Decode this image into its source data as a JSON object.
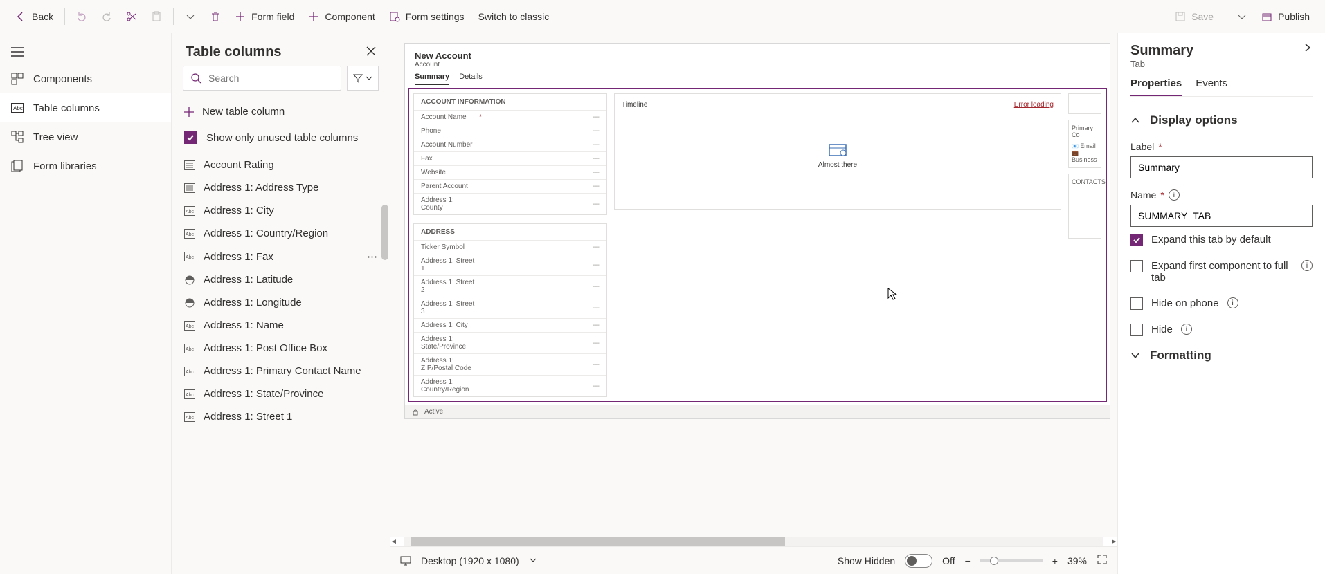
{
  "toolbar": {
    "back": "Back",
    "form_field": "Form field",
    "component": "Component",
    "form_settings": "Form settings",
    "switch_classic": "Switch to classic",
    "save": "Save",
    "publish": "Publish"
  },
  "leftnav": {
    "components": "Components",
    "table_columns": "Table columns",
    "tree_view": "Tree view",
    "form_libraries": "Form libraries"
  },
  "col_panel": {
    "title": "Table columns",
    "search_placeholder": "Search",
    "new_col": "New table column",
    "show_unused": "Show only unused table columns",
    "items": [
      "Account Rating",
      "Address 1: Address Type",
      "Address 1: City",
      "Address 1: Country/Region",
      "Address 1: Fax",
      "Address 1: Latitude",
      "Address 1: Longitude",
      "Address 1: Name",
      "Address 1: Post Office Box",
      "Address 1: Primary Contact Name",
      "Address 1: State/Province",
      "Address 1: Street 1"
    ]
  },
  "form": {
    "title": "New Account",
    "subtitle": "Account",
    "tabs": [
      "Summary",
      "Details"
    ],
    "section_account": {
      "header": "ACCOUNT INFORMATION",
      "fields": [
        {
          "label": "Account Name",
          "required": true
        },
        {
          "label": "Phone"
        },
        {
          "label": "Account Number"
        },
        {
          "label": "Fax"
        },
        {
          "label": "Website"
        },
        {
          "label": "Parent Account"
        },
        {
          "label": "Address 1: County"
        }
      ]
    },
    "section_address": {
      "header": "ADDRESS",
      "fields": [
        {
          "label": "Ticker Symbol"
        },
        {
          "label": "Address 1: Street 1"
        },
        {
          "label": "Address 1: Street 2"
        },
        {
          "label": "Address 1: Street 3"
        },
        {
          "label": "Address 1: City"
        },
        {
          "label": "Address 1: State/Province"
        },
        {
          "label": "Address 1: ZIP/Postal Code"
        },
        {
          "label": "Address 1: Country/Region"
        }
      ]
    },
    "timeline": {
      "header": "Timeline",
      "error": "Error loading",
      "almost": "Almost there"
    },
    "side": {
      "primary": "Primary Co",
      "email": "Email",
      "business": "Business",
      "contacts": "CONTACTS"
    },
    "status": "Active"
  },
  "bottom": {
    "viewport": "Desktop (1920 x 1080)",
    "show_hidden": "Show Hidden",
    "toggle_state": "Off",
    "zoom": "39%"
  },
  "props": {
    "title": "Summary",
    "subtitle": "Tab",
    "tabs": [
      "Properties",
      "Events"
    ],
    "display_options": "Display options",
    "label_field": "Label",
    "label_value": "Summary",
    "name_field": "Name",
    "name_value": "SUMMARY_TAB",
    "expand_default": "Expand this tab by default",
    "expand_first": "Expand first component to full tab",
    "hide_phone": "Hide on phone",
    "hide": "Hide",
    "formatting": "Formatting"
  },
  "dash": "---"
}
